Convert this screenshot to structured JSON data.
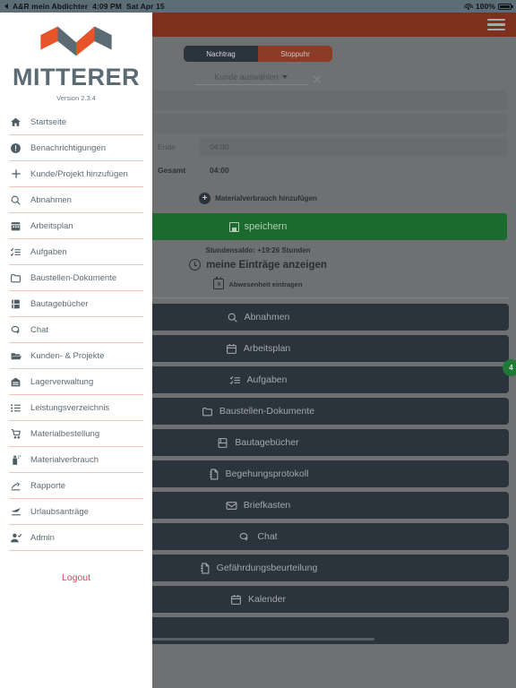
{
  "status_bar": {
    "app_name": "A&R mein Abdichter",
    "time": "4:09 PM",
    "date": "Sat Apr 15",
    "battery_percent": "100%",
    "wifi_icon": "wifi-icon",
    "battery_icon": "battery-icon",
    "back_arrow_icon": "back-arrow-icon"
  },
  "topbar": {
    "menu_icon": "hamburger-menu-icon",
    "background": "#7e2f1d"
  },
  "tabs": {
    "items": [
      {
        "label": "Nachtrag",
        "active": true
      },
      {
        "label": "Stoppuhr",
        "active": false
      }
    ]
  },
  "form": {
    "customer_select": {
      "value": "Kunde auswählen",
      "caret_icon": "chevron-down-icon",
      "clear_icon": "close-icon"
    },
    "end_label": "Ende",
    "end_value": "04:00",
    "total_label": "Gesamt",
    "total_value": "04:00",
    "material_add_label": "Materialverbrauch hinzufügen",
    "material_add_icon": "plus-circle-icon"
  },
  "save": {
    "label": "speichern",
    "icon": "save-disk-icon",
    "color": "#1b6b2e"
  },
  "summary": {
    "balance": "Stundensaldo: +19:26 Stunden",
    "entries_label": "meine Einträge anzeigen",
    "entries_icon": "clock-icon",
    "absence_label": "Abwesenheit eintragen",
    "absence_icon": "calendar-x-icon"
  },
  "actions": [
    {
      "label": "Abnahmen",
      "icon": "search-icon"
    },
    {
      "label": "Arbeitsplan",
      "icon": "calendar-icon"
    },
    {
      "label": "Aufgaben",
      "icon": "checklist-icon",
      "badge": "4"
    },
    {
      "label": "Baustellen-Dokumente",
      "icon": "folder-icon"
    },
    {
      "label": "Bautagebücher",
      "icon": "book-icon"
    },
    {
      "label": "Begehungsprotokoll",
      "icon": "document-icon"
    },
    {
      "label": "Briefkasten",
      "icon": "envelope-icon"
    },
    {
      "label": "Chat",
      "icon": "chat-icon"
    },
    {
      "label": "Gefährdungsbeurteilung",
      "icon": "document-icon"
    },
    {
      "label": "Kalender",
      "icon": "calendar-icon"
    },
    {
      "label": "",
      "icon": ""
    }
  ],
  "sidebar": {
    "brand": "MITTERER",
    "version": "Version 2.3.4",
    "logo_icon": "mitterer-m-logo",
    "logo_colors": {
      "orange": "#e8542a",
      "gray": "#5b6a73"
    },
    "items": [
      {
        "label": "Startseite",
        "icon": "home-icon"
      },
      {
        "label": "Benachrichtigungen",
        "icon": "alert-icon"
      },
      {
        "label": "Kunde/Projekt hinzufügen",
        "icon": "plus-icon"
      },
      {
        "label": "Abnahmen",
        "icon": "search-icon"
      },
      {
        "label": "Arbeitsplan",
        "icon": "calendar-icon"
      },
      {
        "label": "Aufgaben",
        "icon": "checklist-icon"
      },
      {
        "label": "Baustellen-Dokumente",
        "icon": "folder-icon"
      },
      {
        "label": "Bautagebücher",
        "icon": "book-icon"
      },
      {
        "label": "Chat",
        "icon": "chat-icon"
      },
      {
        "label": "Kunden- & Projekte",
        "icon": "open-folder-icon"
      },
      {
        "label": "Lagerverwaltung",
        "icon": "warehouse-icon"
      },
      {
        "label": "Leistungsverzeichnis",
        "icon": "list-icon"
      },
      {
        "label": "Materialbestellung",
        "icon": "cart-icon"
      },
      {
        "label": "Materialverbrauch",
        "icon": "spray-can-icon"
      },
      {
        "label": "Rapporte",
        "icon": "report-icon"
      },
      {
        "label": "Urlaubsanträge",
        "icon": "plane-icon"
      },
      {
        "label": "Admin",
        "icon": "user-check-icon"
      }
    ],
    "logout": "Logout",
    "logout_color": "#f0395b"
  }
}
